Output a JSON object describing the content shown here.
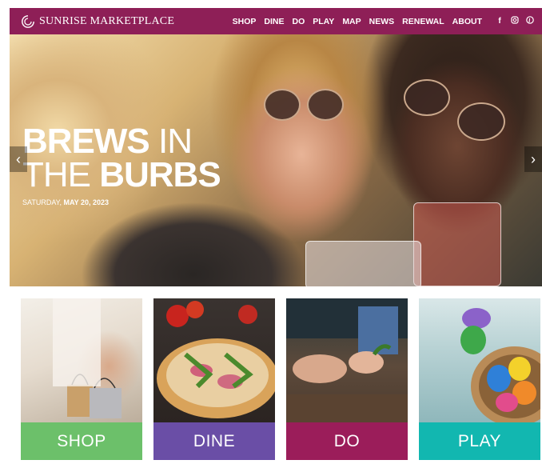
{
  "brand": {
    "name": "SUNRISE MARKETPLACE",
    "color": "#8e1f57"
  },
  "nav": {
    "items": [
      "SHOP",
      "DINE",
      "DO",
      "PLAY",
      "MAP",
      "NEWS",
      "RENEWAL",
      "ABOUT"
    ],
    "social": [
      "facebook-icon",
      "instagram-icon",
      "pinterest-icon"
    ]
  },
  "hero": {
    "title_bold_1": "BREWS",
    "title_thin_1": " IN",
    "title_thin_2": "THE ",
    "title_bold_2": "BURBS",
    "date_day": "SATURDAY, ",
    "date_main": "MAY 20, 2023",
    "prev_icon": "‹",
    "next_icon": "›"
  },
  "cards": [
    {
      "label": "SHOP",
      "color": "#6cc06a"
    },
    {
      "label": "DINE",
      "color": "#6a4ea6"
    },
    {
      "label": "DO",
      "color": "#9b1d5a"
    },
    {
      "label": "PLAY",
      "color": "#12b7b0"
    }
  ]
}
